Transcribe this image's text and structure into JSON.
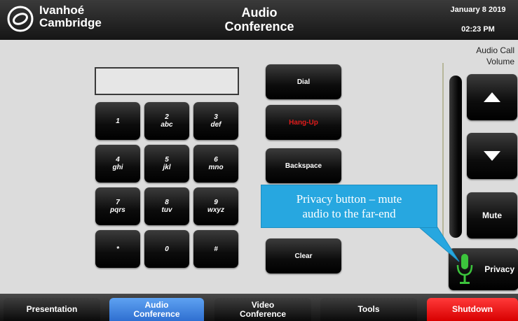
{
  "header": {
    "brand_line1": "Ivanhoé",
    "brand_line2": "Cambridge",
    "title_line1": "Audio",
    "title_line2": "Conference",
    "date": "January 8 2019",
    "time": "02:23 PM"
  },
  "dialer": {
    "display_value": "",
    "keys": [
      {
        "num": "1",
        "sub": ""
      },
      {
        "num": "2",
        "sub": "abc"
      },
      {
        "num": "3",
        "sub": "def"
      },
      {
        "num": "4",
        "sub": "ghi"
      },
      {
        "num": "5",
        "sub": "jkl"
      },
      {
        "num": "6",
        "sub": "mno"
      },
      {
        "num": "7",
        "sub": "pqrs"
      },
      {
        "num": "8",
        "sub": "tuv"
      },
      {
        "num": "9",
        "sub": "wxyz"
      },
      {
        "num": "*",
        "sub": ""
      },
      {
        "num": "0",
        "sub": ""
      },
      {
        "num": "#",
        "sub": ""
      }
    ],
    "dial_label": "Dial",
    "hangup_label": "Hang-Up",
    "backspace_label": "Backspace",
    "clear_label": "Clear"
  },
  "volume": {
    "label_line1": "Audio Call",
    "label_line2": "Volume",
    "mute_label": "Mute",
    "privacy_label": "Privacy"
  },
  "callout": {
    "line1": "Privacy button – mute",
    "line2": "audio to the far-end"
  },
  "tabs": [
    {
      "line1": "Presentation",
      "line2": ""
    },
    {
      "line1": "Audio",
      "line2": "Conference"
    },
    {
      "line1": "Video",
      "line2": "Conference"
    },
    {
      "line1": "Tools",
      "line2": ""
    },
    {
      "line1": "Shutdown",
      "line2": ""
    }
  ],
  "colors": {
    "active_tab": "#3f84e5",
    "shutdown": "#e60000",
    "hangup_text": "#e11b1b",
    "callout_bg": "#27a7e0",
    "mic_green": "#3cc43c"
  }
}
